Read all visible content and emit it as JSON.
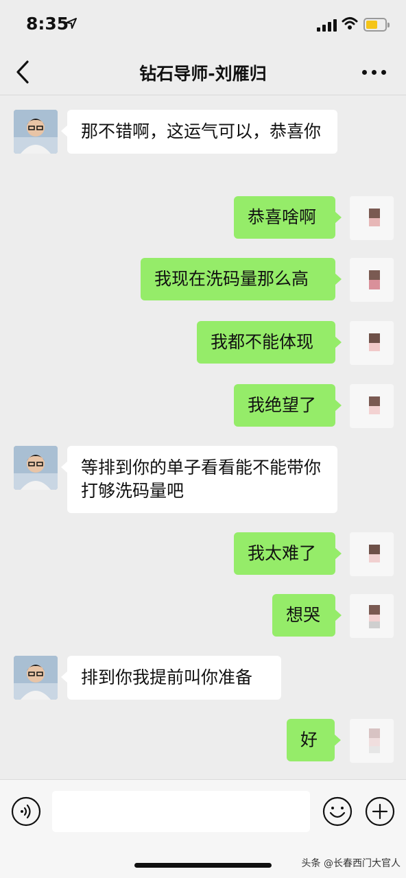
{
  "status_bar": {
    "time": "8:35"
  },
  "chat": {
    "title": "钻石导师-刘雁归"
  },
  "messages": [
    {
      "side": "left",
      "text": "那不错啊，这运气可以，恭喜你"
    },
    {
      "side": "right",
      "text": "恭喜啥啊"
    },
    {
      "side": "right",
      "text": "我现在洗码量那么高"
    },
    {
      "side": "right",
      "text": "我都不能体现"
    },
    {
      "side": "right",
      "text": "我绝望了"
    },
    {
      "side": "left",
      "text": "等排到你的单子看看能不能带你打够洗码量吧"
    },
    {
      "side": "right",
      "text": "我太难了"
    },
    {
      "side": "right",
      "text": "想哭"
    },
    {
      "side": "left",
      "text": "排到你我提前叫你准备"
    },
    {
      "side": "right",
      "text": "好"
    }
  ],
  "input": {
    "value": ""
  },
  "watermark": "头条 @长春西门大官人"
}
